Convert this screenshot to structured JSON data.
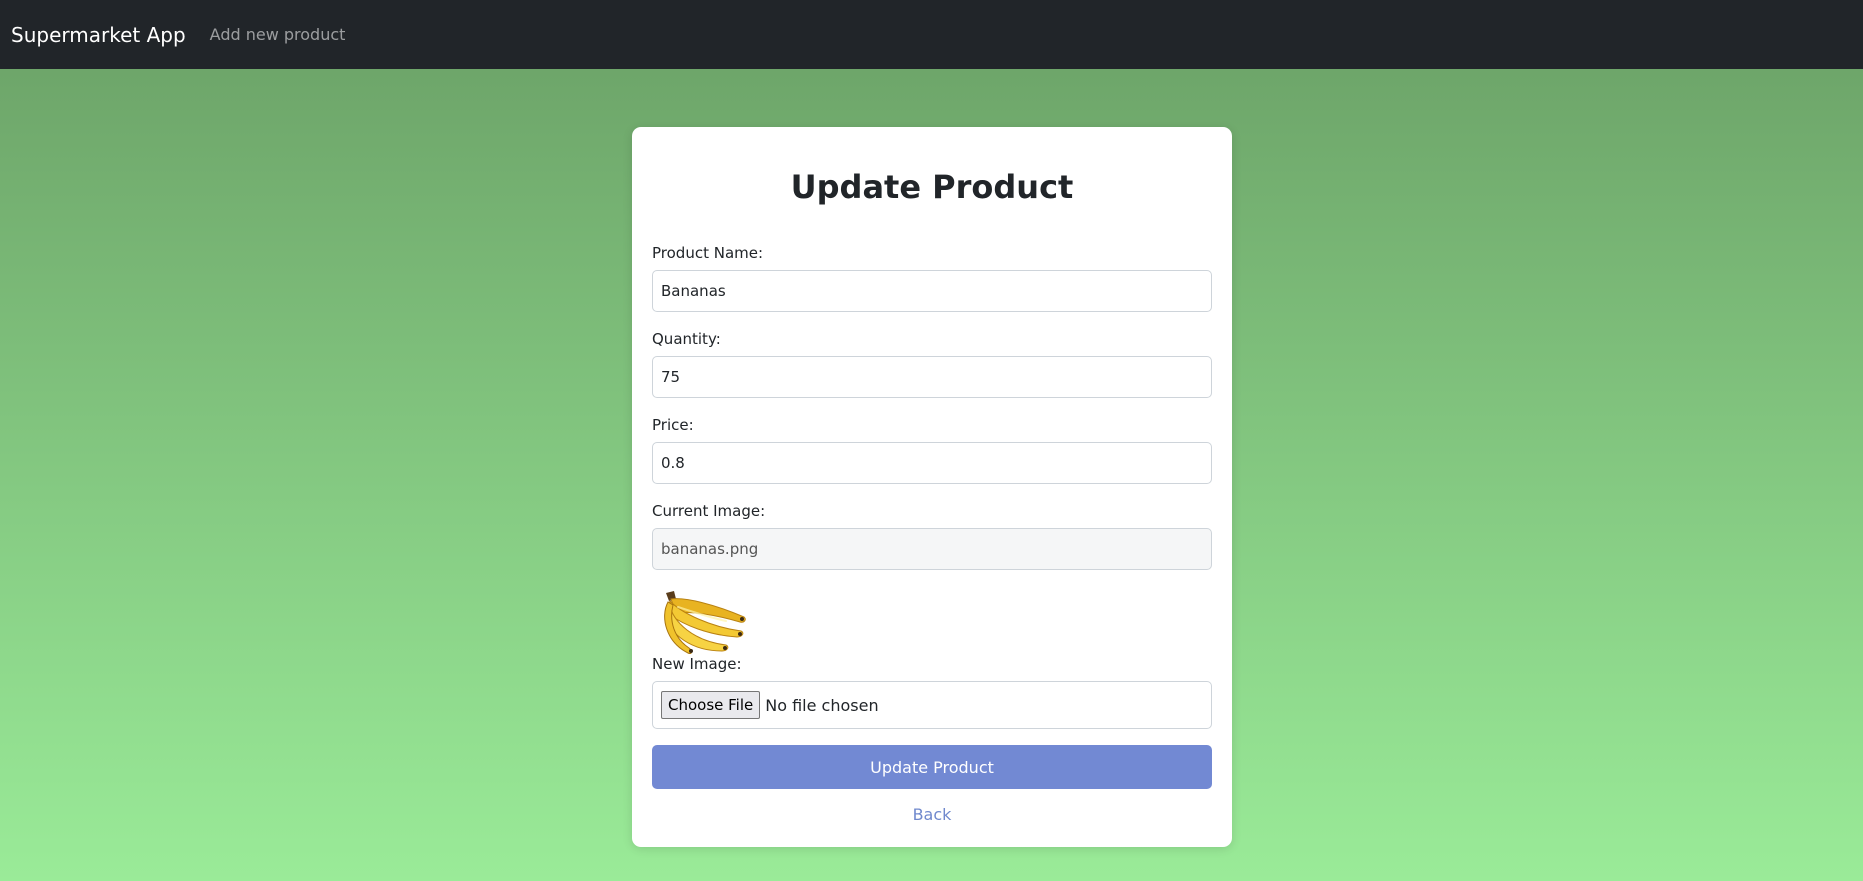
{
  "navbar": {
    "brand": "Supermarket App",
    "links": [
      {
        "label": "Add new product"
      }
    ]
  },
  "form": {
    "title": "Update Product",
    "fields": {
      "name": {
        "label": "Product Name:",
        "value": "Bananas"
      },
      "quantity": {
        "label": "Quantity:",
        "value": "75"
      },
      "price": {
        "label": "Price:",
        "value": "0.8"
      },
      "current_image": {
        "label": "Current Image:",
        "value": "bananas.png"
      }
    },
    "new_image": {
      "label": "New Image:",
      "button_label": "Choose File",
      "status": "No file chosen"
    },
    "submit_label": "Update Product",
    "back_label": "Back"
  },
  "colors": {
    "navbar": "#212529",
    "gradient_top": "#6aa066",
    "gradient_bottom": "#9aeb98",
    "button": "#7289d3",
    "link": "#7089cd"
  },
  "icons": {
    "thumbnail": "banana-bunch-image"
  }
}
